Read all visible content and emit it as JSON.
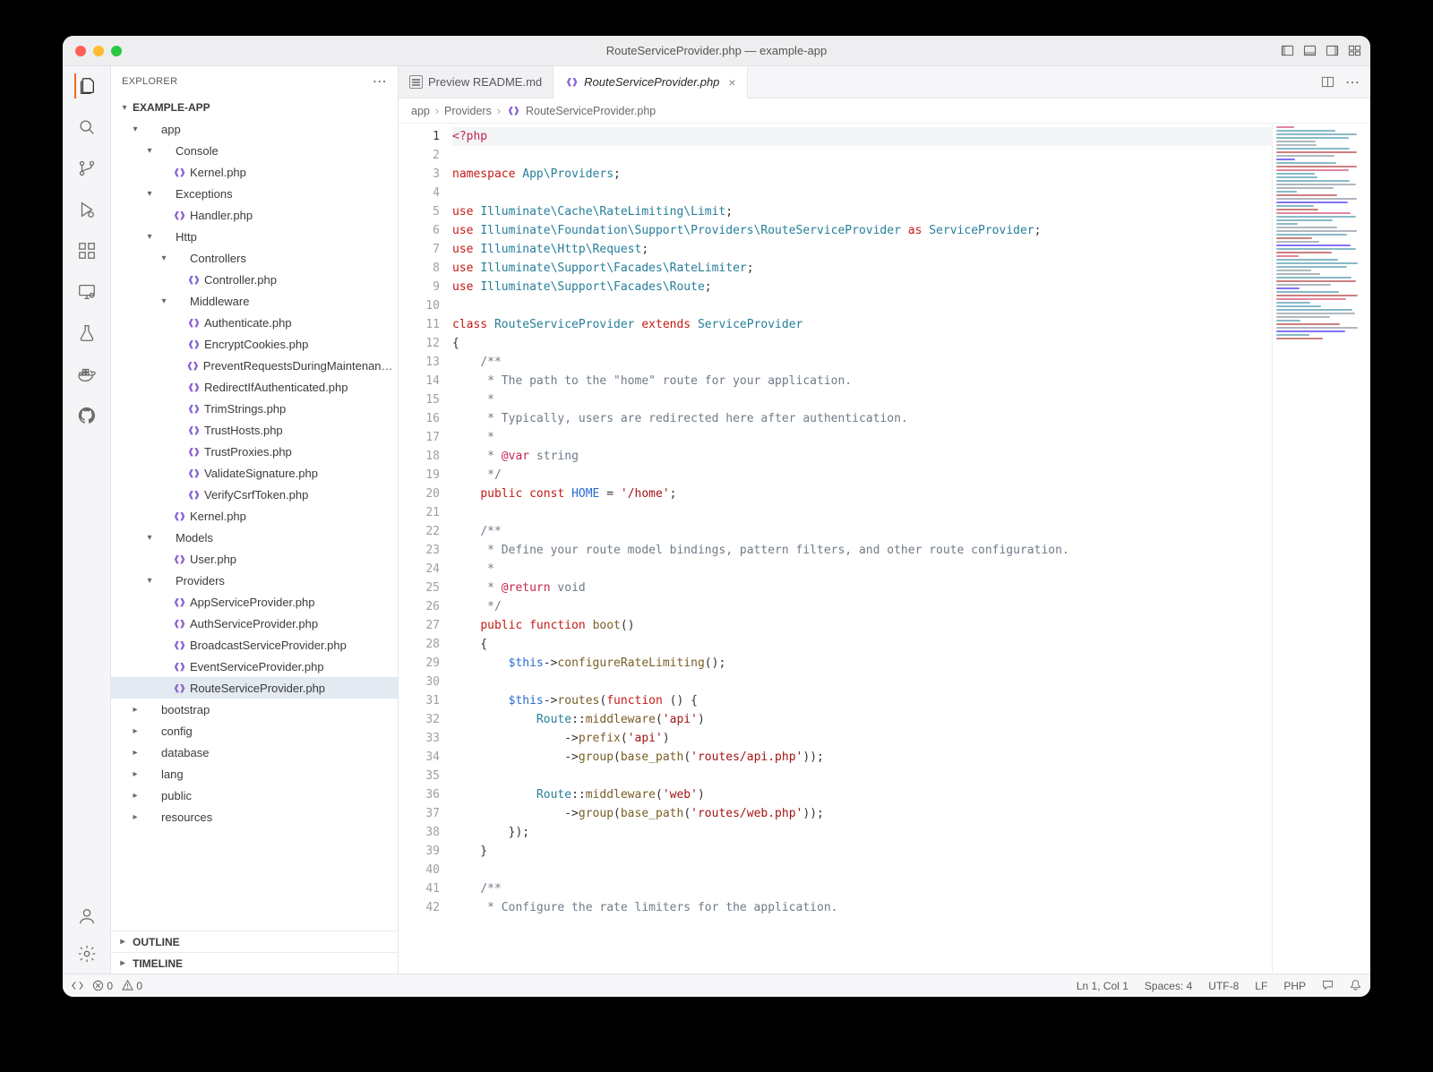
{
  "window": {
    "title": "RouteServiceProvider.php — example-app"
  },
  "explorer": {
    "heading": "EXPLORER",
    "workspace": "EXAMPLE-APP",
    "extraPanels": [
      {
        "label": "OUTLINE"
      },
      {
        "label": "TIMELINE"
      }
    ],
    "tree": [
      {
        "d": 0,
        "kind": "folder",
        "open": true,
        "label": "app"
      },
      {
        "d": 1,
        "kind": "folder",
        "open": true,
        "label": "Console"
      },
      {
        "d": 2,
        "kind": "php",
        "label": "Kernel.php"
      },
      {
        "d": 1,
        "kind": "folder",
        "open": true,
        "label": "Exceptions"
      },
      {
        "d": 2,
        "kind": "php",
        "label": "Handler.php"
      },
      {
        "d": 1,
        "kind": "folder",
        "open": true,
        "label": "Http"
      },
      {
        "d": 2,
        "kind": "folder",
        "open": true,
        "label": "Controllers"
      },
      {
        "d": 3,
        "kind": "php",
        "label": "Controller.php"
      },
      {
        "d": 2,
        "kind": "folder",
        "open": true,
        "label": "Middleware"
      },
      {
        "d": 3,
        "kind": "php",
        "label": "Authenticate.php"
      },
      {
        "d": 3,
        "kind": "php",
        "label": "EncryptCookies.php"
      },
      {
        "d": 3,
        "kind": "php",
        "label": "PreventRequestsDuringMaintenance.php"
      },
      {
        "d": 3,
        "kind": "php",
        "label": "RedirectIfAuthenticated.php"
      },
      {
        "d": 3,
        "kind": "php",
        "label": "TrimStrings.php"
      },
      {
        "d": 3,
        "kind": "php",
        "label": "TrustHosts.php"
      },
      {
        "d": 3,
        "kind": "php",
        "label": "TrustProxies.php"
      },
      {
        "d": 3,
        "kind": "php",
        "label": "ValidateSignature.php"
      },
      {
        "d": 3,
        "kind": "php",
        "label": "VerifyCsrfToken.php"
      },
      {
        "d": 2,
        "kind": "php",
        "label": "Kernel.php"
      },
      {
        "d": 1,
        "kind": "folder",
        "open": true,
        "label": "Models"
      },
      {
        "d": 2,
        "kind": "php",
        "label": "User.php"
      },
      {
        "d": 1,
        "kind": "folder",
        "open": true,
        "label": "Providers"
      },
      {
        "d": 2,
        "kind": "php",
        "label": "AppServiceProvider.php"
      },
      {
        "d": 2,
        "kind": "php",
        "label": "AuthServiceProvider.php"
      },
      {
        "d": 2,
        "kind": "php",
        "label": "BroadcastServiceProvider.php"
      },
      {
        "d": 2,
        "kind": "php",
        "label": "EventServiceProvider.php"
      },
      {
        "d": 2,
        "kind": "php",
        "label": "RouteServiceProvider.php",
        "selected": true
      },
      {
        "d": 0,
        "kind": "folder",
        "open": false,
        "label": "bootstrap"
      },
      {
        "d": 0,
        "kind": "folder",
        "open": false,
        "label": "config"
      },
      {
        "d": 0,
        "kind": "folder",
        "open": false,
        "label": "database"
      },
      {
        "d": 0,
        "kind": "folder",
        "open": false,
        "label": "lang"
      },
      {
        "d": 0,
        "kind": "folder",
        "open": false,
        "label": "public"
      },
      {
        "d": 0,
        "kind": "folder",
        "open": false,
        "label": "resources"
      }
    ]
  },
  "tabs": [
    {
      "icon": "preview",
      "label": "Preview README.md",
      "active": false,
      "closable": false
    },
    {
      "icon": "php",
      "label": "RouteServiceProvider.php",
      "active": true,
      "italic": true,
      "closable": true
    }
  ],
  "breadcrumb": [
    {
      "label": "app",
      "icon": null
    },
    {
      "label": "Providers",
      "icon": null
    },
    {
      "label": "RouteServiceProvider.php",
      "icon": "php"
    }
  ],
  "code": {
    "lines": [
      [
        {
          "c": "t-red",
          "t": "<?php"
        }
      ],
      [
        {
          "c": "",
          "t": ""
        }
      ],
      [
        {
          "c": "t-kw",
          "t": "namespace"
        },
        {
          "c": "",
          "t": " "
        },
        {
          "c": "t-ns",
          "t": "App\\Providers"
        },
        {
          "c": "",
          "t": ";"
        }
      ],
      [
        {
          "c": "",
          "t": ""
        }
      ],
      [
        {
          "c": "t-kw",
          "t": "use"
        },
        {
          "c": "",
          "t": " "
        },
        {
          "c": "t-ns",
          "t": "Illuminate\\Cache\\RateLimiting\\Limit"
        },
        {
          "c": "",
          "t": ";"
        }
      ],
      [
        {
          "c": "t-kw",
          "t": "use"
        },
        {
          "c": "",
          "t": " "
        },
        {
          "c": "t-ns",
          "t": "Illuminate\\Foundation\\Support\\Providers\\RouteServiceProvider"
        },
        {
          "c": "",
          "t": " "
        },
        {
          "c": "t-kw",
          "t": "as"
        },
        {
          "c": "",
          "t": " "
        },
        {
          "c": "t-cls",
          "t": "ServiceProvider"
        },
        {
          "c": "",
          "t": ";"
        }
      ],
      [
        {
          "c": "t-kw",
          "t": "use"
        },
        {
          "c": "",
          "t": " "
        },
        {
          "c": "t-ns",
          "t": "Illuminate\\Http\\Request"
        },
        {
          "c": "",
          "t": ";"
        }
      ],
      [
        {
          "c": "t-kw",
          "t": "use"
        },
        {
          "c": "",
          "t": " "
        },
        {
          "c": "t-ns",
          "t": "Illuminate\\Support\\Facades\\RateLimiter"
        },
        {
          "c": "",
          "t": ";"
        }
      ],
      [
        {
          "c": "t-kw",
          "t": "use"
        },
        {
          "c": "",
          "t": " "
        },
        {
          "c": "t-ns",
          "t": "Illuminate\\Support\\Facades\\Route"
        },
        {
          "c": "",
          "t": ";"
        }
      ],
      [
        {
          "c": "",
          "t": ""
        }
      ],
      [
        {
          "c": "t-kw",
          "t": "class"
        },
        {
          "c": "",
          "t": " "
        },
        {
          "c": "t-cls",
          "t": "RouteServiceProvider"
        },
        {
          "c": "",
          "t": " "
        },
        {
          "c": "t-kw",
          "t": "extends"
        },
        {
          "c": "",
          "t": " "
        },
        {
          "c": "t-cls",
          "t": "ServiceProvider"
        }
      ],
      [
        {
          "c": "",
          "t": "{"
        }
      ],
      [
        {
          "c": "",
          "t": "    "
        },
        {
          "c": "t-com",
          "t": "/**"
        }
      ],
      [
        {
          "c": "",
          "t": "    "
        },
        {
          "c": "t-com",
          "t": " * The path to the \"home\" route for your application."
        }
      ],
      [
        {
          "c": "",
          "t": "    "
        },
        {
          "c": "t-com",
          "t": " *"
        }
      ],
      [
        {
          "c": "",
          "t": "    "
        },
        {
          "c": "t-com",
          "t": " * Typically, users are redirected here after authentication."
        }
      ],
      [
        {
          "c": "",
          "t": "    "
        },
        {
          "c": "t-com",
          "t": " *"
        }
      ],
      [
        {
          "c": "",
          "t": "    "
        },
        {
          "c": "t-com",
          "t": " * "
        },
        {
          "c": "t-tag",
          "t": "@var"
        },
        {
          "c": "t-com",
          "t": " string"
        }
      ],
      [
        {
          "c": "",
          "t": "    "
        },
        {
          "c": "t-com",
          "t": " */"
        }
      ],
      [
        {
          "c": "",
          "t": "    "
        },
        {
          "c": "t-kw",
          "t": "public"
        },
        {
          "c": "",
          "t": " "
        },
        {
          "c": "t-kw",
          "t": "const"
        },
        {
          "c": "",
          "t": " "
        },
        {
          "c": "t-const",
          "t": "HOME"
        },
        {
          "c": "",
          "t": " = "
        },
        {
          "c": "t-str",
          "t": "'/home'"
        },
        {
          "c": "",
          "t": ";"
        }
      ],
      [
        {
          "c": "",
          "t": ""
        }
      ],
      [
        {
          "c": "",
          "t": "    "
        },
        {
          "c": "t-com",
          "t": "/**"
        }
      ],
      [
        {
          "c": "",
          "t": "    "
        },
        {
          "c": "t-com",
          "t": " * Define your route model bindings, pattern filters, and other route configuration."
        }
      ],
      [
        {
          "c": "",
          "t": "    "
        },
        {
          "c": "t-com",
          "t": " *"
        }
      ],
      [
        {
          "c": "",
          "t": "    "
        },
        {
          "c": "t-com",
          "t": " * "
        },
        {
          "c": "t-tag",
          "t": "@return"
        },
        {
          "c": "t-com",
          "t": " void"
        }
      ],
      [
        {
          "c": "",
          "t": "    "
        },
        {
          "c": "t-com",
          "t": " */"
        }
      ],
      [
        {
          "c": "",
          "t": "    "
        },
        {
          "c": "t-kw",
          "t": "public"
        },
        {
          "c": "",
          "t": " "
        },
        {
          "c": "t-kw",
          "t": "function"
        },
        {
          "c": "",
          "t": " "
        },
        {
          "c": "t-call",
          "t": "boot"
        },
        {
          "c": "",
          "t": "()"
        }
      ],
      [
        {
          "c": "",
          "t": "    {"
        }
      ],
      [
        {
          "c": "",
          "t": "        "
        },
        {
          "c": "t-var",
          "t": "$this"
        },
        {
          "c": "",
          "t": "->"
        },
        {
          "c": "t-call",
          "t": "configureRateLimiting"
        },
        {
          "c": "",
          "t": "();"
        }
      ],
      [
        {
          "c": "",
          "t": ""
        }
      ],
      [
        {
          "c": "",
          "t": "        "
        },
        {
          "c": "t-var",
          "t": "$this"
        },
        {
          "c": "",
          "t": "->"
        },
        {
          "c": "t-call",
          "t": "routes"
        },
        {
          "c": "",
          "t": "("
        },
        {
          "c": "t-kw",
          "t": "function"
        },
        {
          "c": "",
          "t": " () {"
        }
      ],
      [
        {
          "c": "",
          "t": "            "
        },
        {
          "c": "t-cls",
          "t": "Route"
        },
        {
          "c": "",
          "t": "::"
        },
        {
          "c": "t-call",
          "t": "middleware"
        },
        {
          "c": "",
          "t": "("
        },
        {
          "c": "t-str",
          "t": "'api'"
        },
        {
          "c": "",
          "t": ")"
        }
      ],
      [
        {
          "c": "",
          "t": "                ->"
        },
        {
          "c": "t-call",
          "t": "prefix"
        },
        {
          "c": "",
          "t": "("
        },
        {
          "c": "t-str",
          "t": "'api'"
        },
        {
          "c": "",
          "t": ")"
        }
      ],
      [
        {
          "c": "",
          "t": "                ->"
        },
        {
          "c": "t-call",
          "t": "group"
        },
        {
          "c": "",
          "t": "("
        },
        {
          "c": "t-call",
          "t": "base_path"
        },
        {
          "c": "",
          "t": "("
        },
        {
          "c": "t-str",
          "t": "'routes/api.php'"
        },
        {
          "c": "",
          "t": "));"
        }
      ],
      [
        {
          "c": "",
          "t": ""
        }
      ],
      [
        {
          "c": "",
          "t": "            "
        },
        {
          "c": "t-cls",
          "t": "Route"
        },
        {
          "c": "",
          "t": "::"
        },
        {
          "c": "t-call",
          "t": "middleware"
        },
        {
          "c": "",
          "t": "("
        },
        {
          "c": "t-str",
          "t": "'web'"
        },
        {
          "c": "",
          "t": ")"
        }
      ],
      [
        {
          "c": "",
          "t": "                ->"
        },
        {
          "c": "t-call",
          "t": "group"
        },
        {
          "c": "",
          "t": "("
        },
        {
          "c": "t-call",
          "t": "base_path"
        },
        {
          "c": "",
          "t": "("
        },
        {
          "c": "t-str",
          "t": "'routes/web.php'"
        },
        {
          "c": "",
          "t": "));"
        }
      ],
      [
        {
          "c": "",
          "t": "        });"
        }
      ],
      [
        {
          "c": "",
          "t": "    }"
        }
      ],
      [
        {
          "c": "",
          "t": ""
        }
      ],
      [
        {
          "c": "",
          "t": "    "
        },
        {
          "c": "t-com",
          "t": "/**"
        }
      ],
      [
        {
          "c": "",
          "t": "    "
        },
        {
          "c": "t-com",
          "t": " * Configure the rate limiters for the application."
        }
      ]
    ]
  },
  "status": {
    "errors": "0",
    "warnings": "0",
    "cursor": "Ln 1, Col 1",
    "spaces": "Spaces: 4",
    "encoding": "UTF-8",
    "eol": "LF",
    "language": "PHP"
  }
}
